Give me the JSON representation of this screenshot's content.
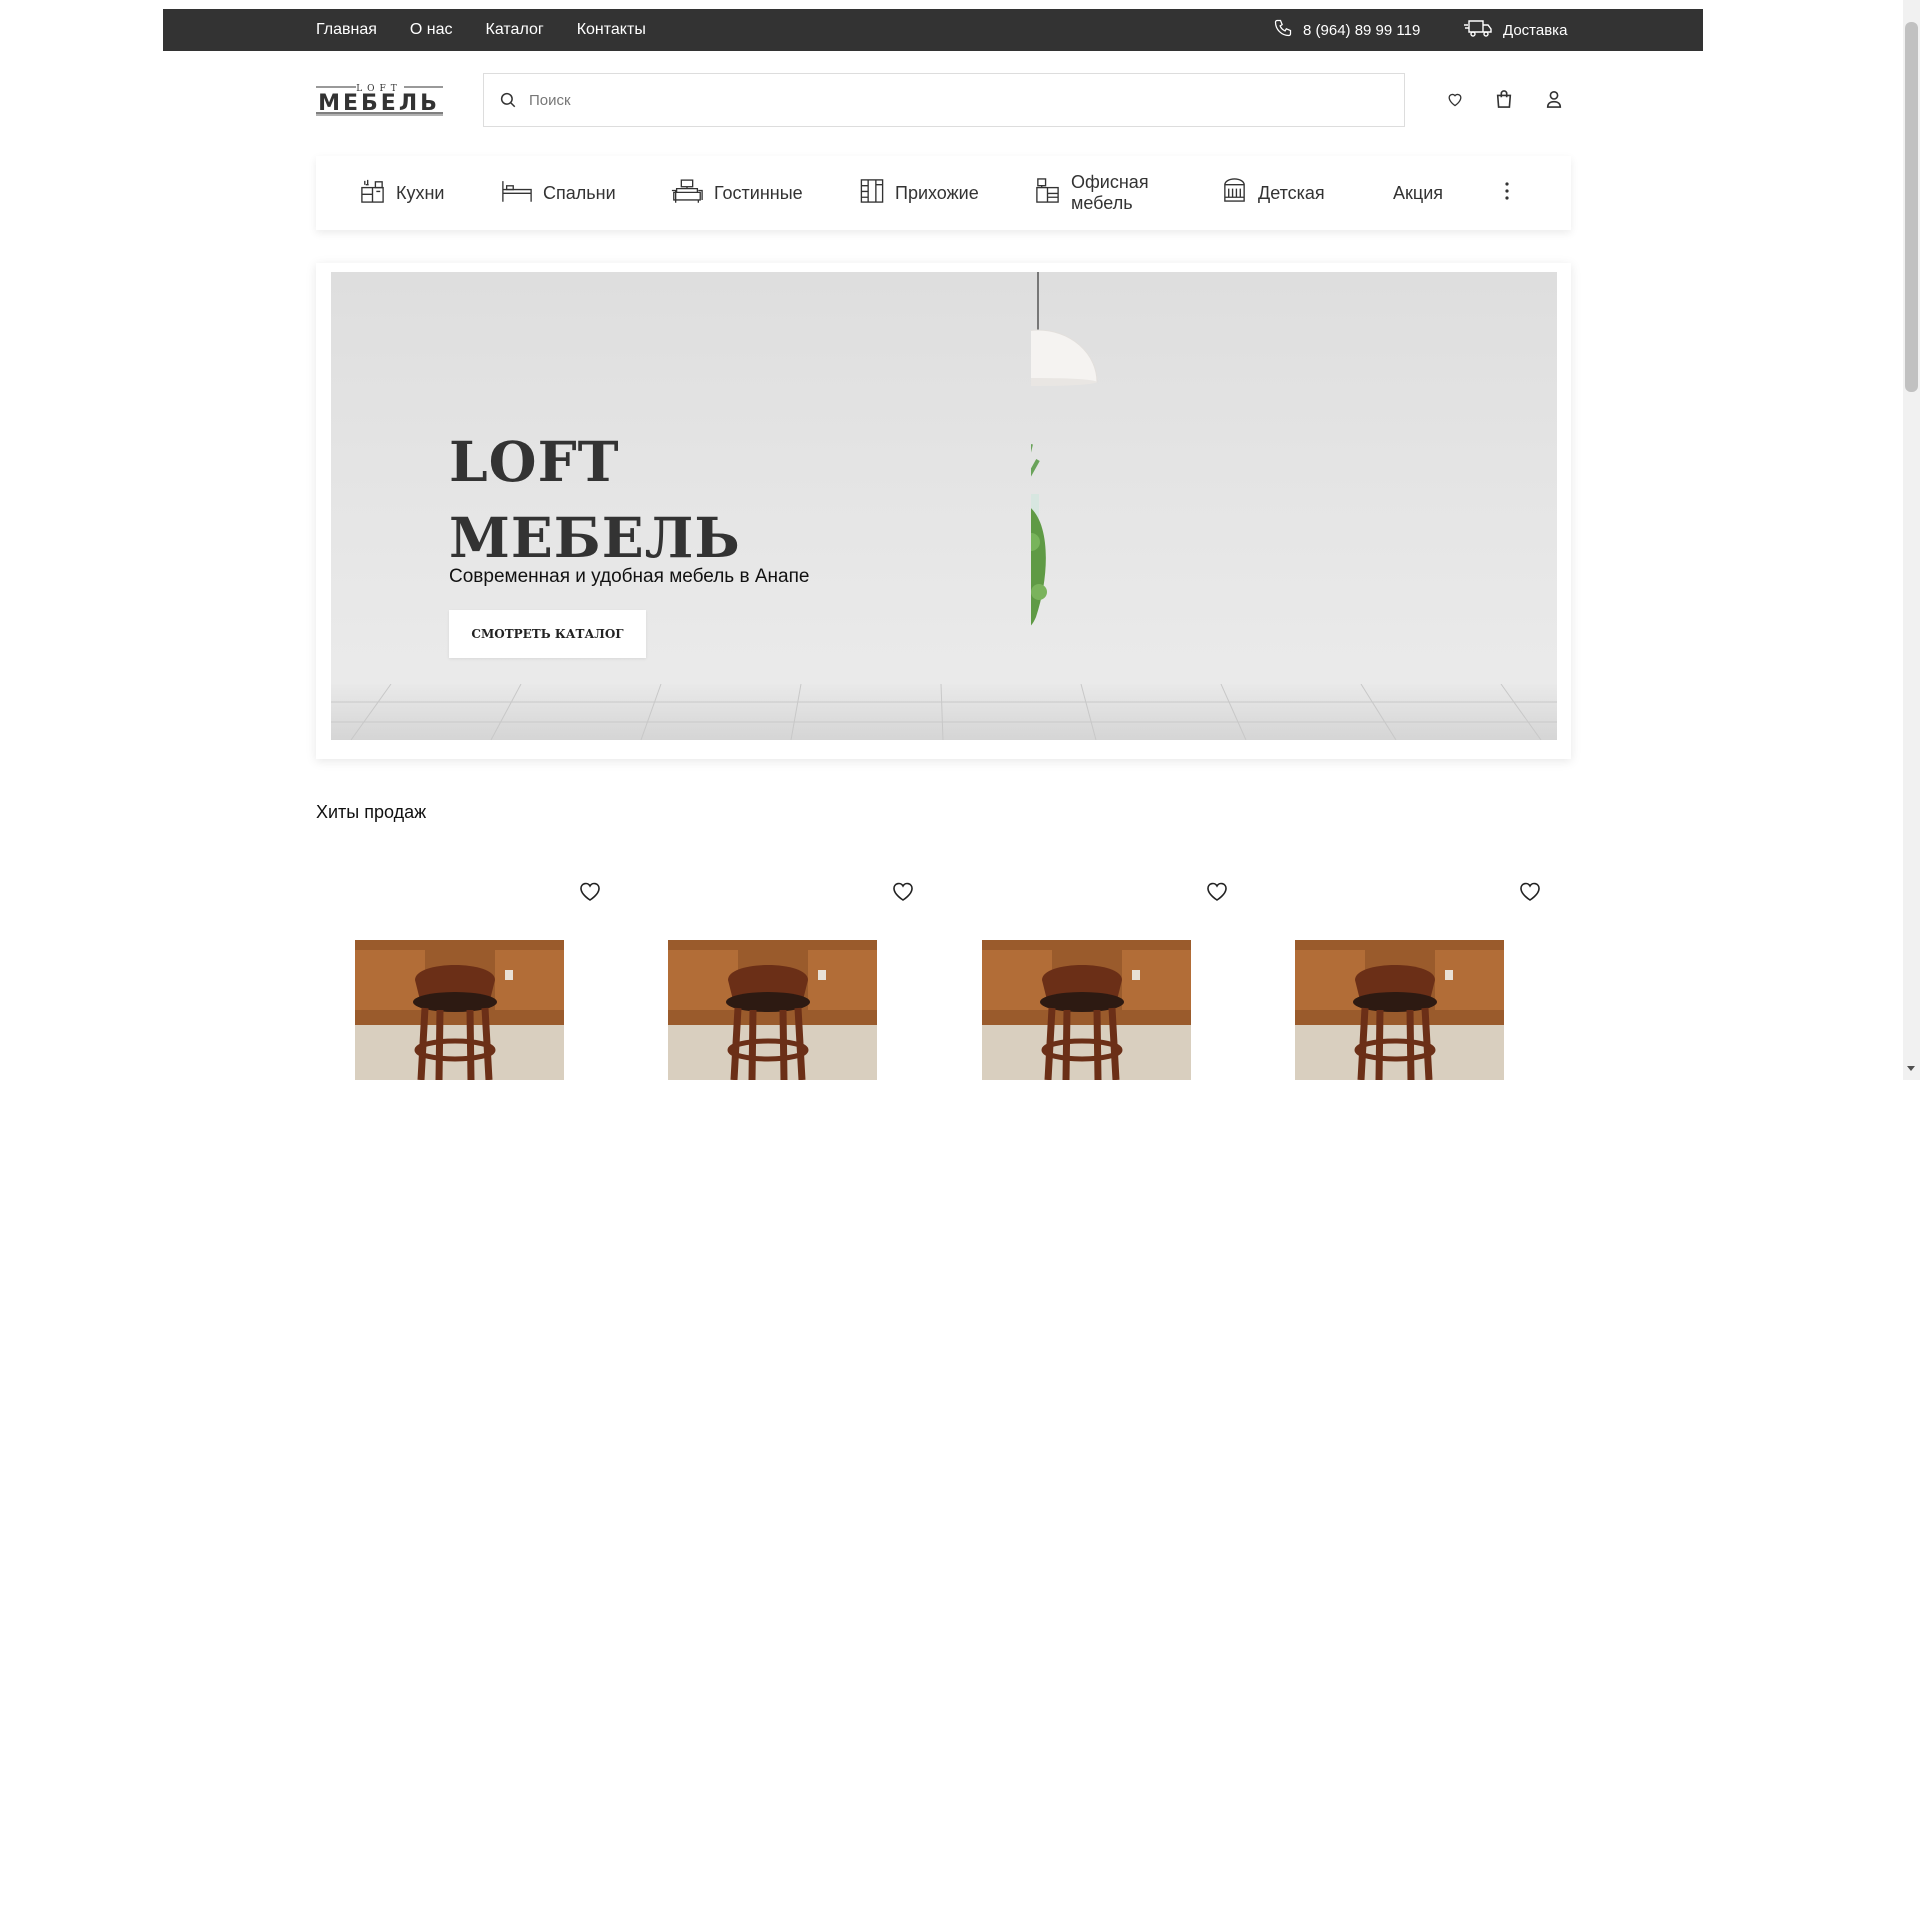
{
  "topbar": {
    "nav": [
      "Главная",
      "О нас",
      "Каталог",
      "Контакты"
    ],
    "phone": "8 (964) 89 99 119",
    "delivery": "Доставка"
  },
  "header": {
    "logo_top": "LOFT",
    "logo_main": "МЕБЕЛЬ",
    "search_placeholder": "Поиск"
  },
  "categories": [
    {
      "label": "Кухни",
      "icon": "kitchen-icon"
    },
    {
      "label": "Спальни",
      "icon": "bed-icon"
    },
    {
      "label": "Гостинные",
      "icon": "sofa-icon"
    },
    {
      "label": "Прихожие",
      "icon": "wardrobe-icon"
    },
    {
      "label": "Офисная мебель",
      "label_line1": "Офисная",
      "label_line2": "мебель",
      "icon": "office-desk-icon"
    },
    {
      "label": "Детская",
      "icon": "crib-icon"
    },
    {
      "label": "Акция",
      "icon": ""
    }
  ],
  "hero": {
    "title_line1": "LOFT",
    "title_line2": "МЕБЕЛЬ",
    "subtitle": "Современная и удобная мебель в Анапе",
    "button": "СМОТРЕТЬ КАТАЛОГ"
  },
  "hits": {
    "title": "Хиты продаж",
    "count": 4
  },
  "colors": {
    "topbar": "#333333",
    "text": "#222222"
  }
}
